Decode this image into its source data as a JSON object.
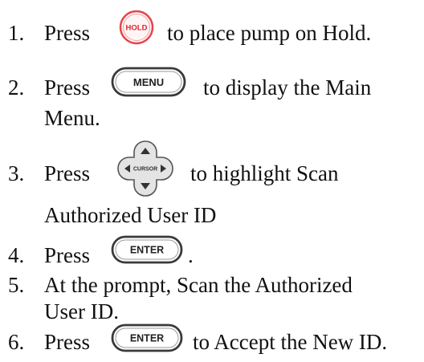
{
  "steps": [
    {
      "number": "1.",
      "before": "Press",
      "button_icon": "hold-button-icon",
      "button_label": "HOLD",
      "after": "to place pump on Hold."
    },
    {
      "number": "2.",
      "before": "Press",
      "button_icon": "menu-button-icon",
      "button_label": "MENU",
      "after": "to display the Main",
      "continuation": "Menu."
    },
    {
      "number": "3.",
      "before": "Press",
      "button_icon": "cursor-pad-icon",
      "button_label": "CURSOR",
      "after": "to highlight Scan",
      "continuation": "Authorized User ID"
    },
    {
      "number": "4.",
      "before": "Press",
      "button_icon": "enter-button-icon",
      "button_label": "ENTER",
      "after": "."
    },
    {
      "number": "5.",
      "text": "At the prompt, Scan the Authorized",
      "continuation": "User ID."
    },
    {
      "number": "6.",
      "before": "Press",
      "button_icon": "enter-button-icon",
      "button_label": "ENTER",
      "after": "to Accept the New ID."
    }
  ],
  "colors": {
    "hold_border": "#e0474c",
    "hold_text": "#d6262b",
    "button_border": "#3a3a3a",
    "cursor_fill": "#dcdcdc"
  }
}
